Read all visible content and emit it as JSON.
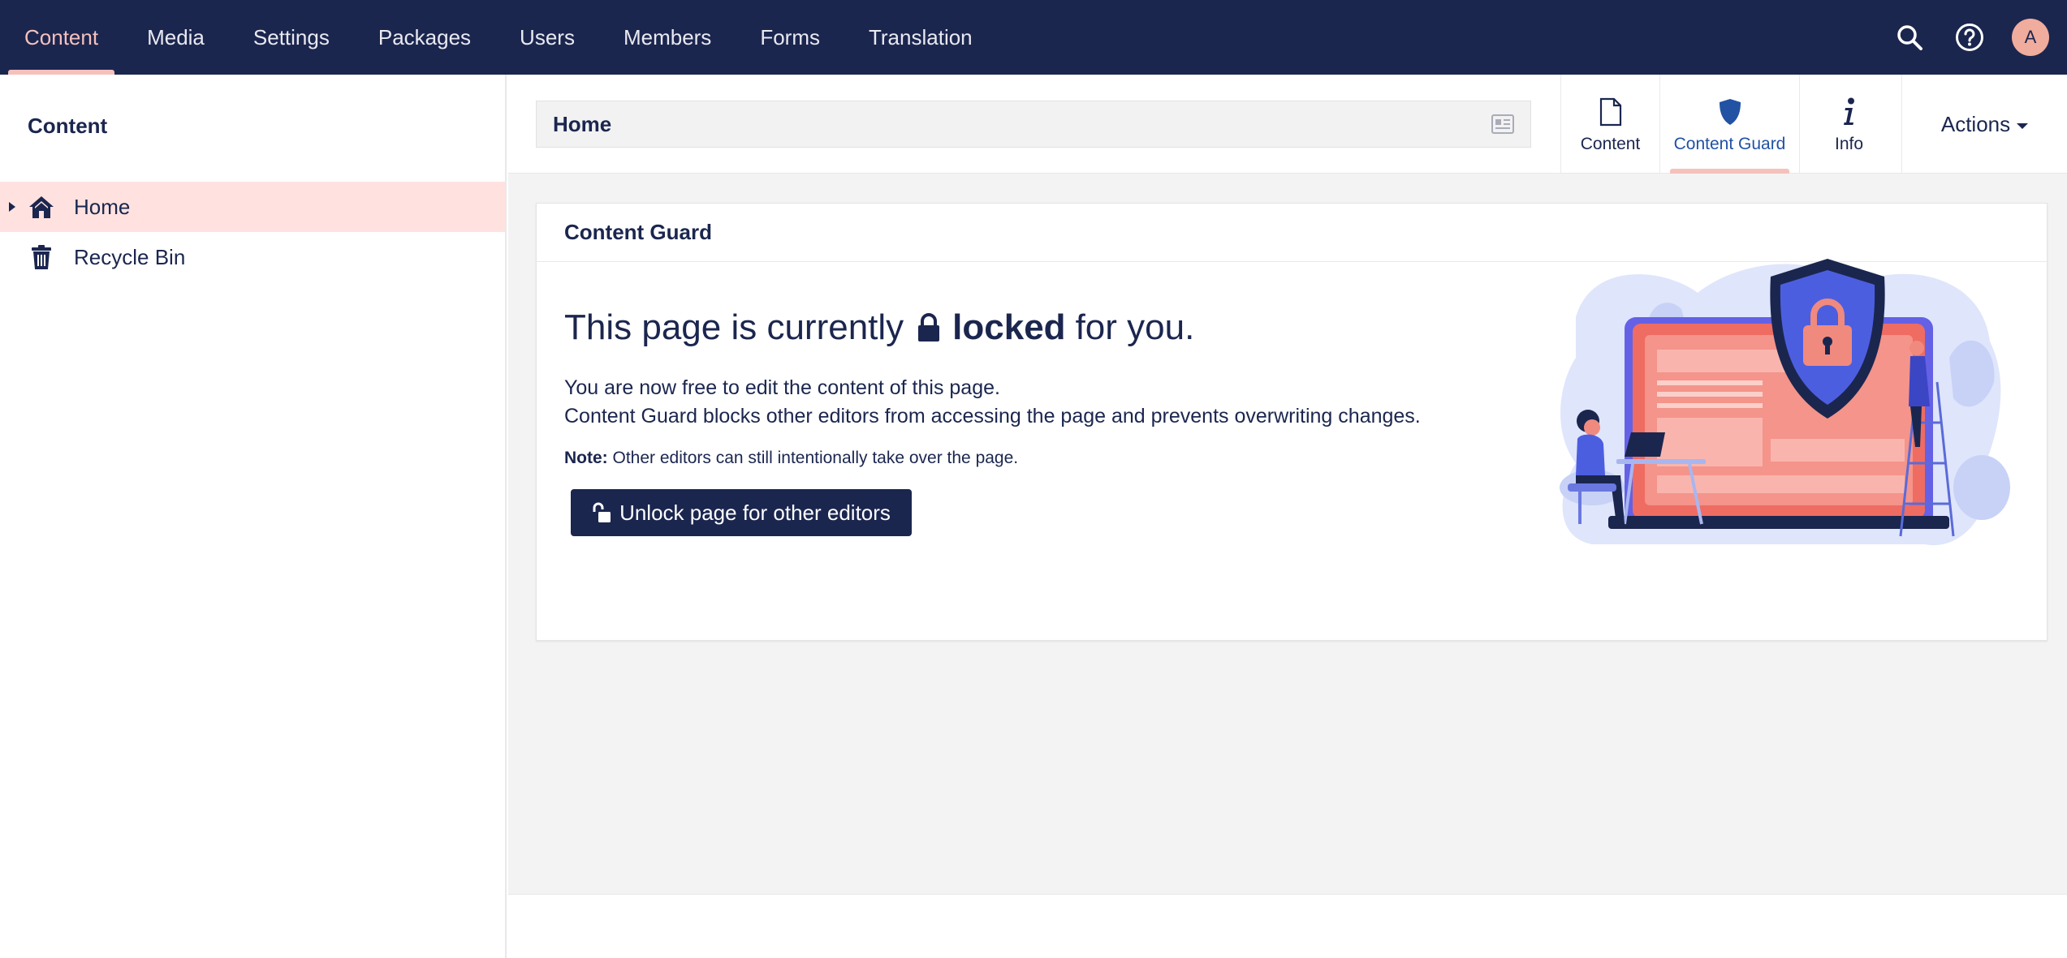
{
  "topnav": {
    "items": [
      {
        "label": "Content",
        "active": true
      },
      {
        "label": "Media"
      },
      {
        "label": "Settings"
      },
      {
        "label": "Packages"
      },
      {
        "label": "Users"
      },
      {
        "label": "Members"
      },
      {
        "label": "Forms"
      },
      {
        "label": "Translation"
      }
    ],
    "tools": {
      "search_icon": "search-icon",
      "help_icon": "help-icon",
      "avatar_initial": "A"
    }
  },
  "sidebar": {
    "title": "Content",
    "tree": [
      {
        "label": "Home",
        "icon": "home-icon",
        "selected": true
      },
      {
        "label": "Recycle Bin",
        "icon": "trash-icon"
      }
    ]
  },
  "editor": {
    "node_name": "Home",
    "tabs": [
      {
        "label": "Content",
        "icon": "document-icon"
      },
      {
        "label": "Content Guard",
        "icon": "shield-icon",
        "active": true
      },
      {
        "label": "Info",
        "icon": "info-icon"
      }
    ],
    "actions_label": "Actions"
  },
  "guard_panel": {
    "title": "Content Guard",
    "headline_before": "This page is currently",
    "headline_bold": "locked",
    "headline_after": "for you.",
    "line1": "You are now free to edit the content of this page.",
    "line2": "Content Guard blocks other editors from accessing the page and prevents overwriting changes.",
    "note_label": "Note:",
    "note_text": "Other editors can still intentionally take over the page.",
    "unlock_button": "Unlock page for other editors"
  },
  "colors": {
    "nav_bg": "#1b264f",
    "accent_pink": "#f5c1bc",
    "selected_row": "#ffe2df",
    "active_tab_text": "#2152a3",
    "main_bg": "#f4f3f3"
  }
}
